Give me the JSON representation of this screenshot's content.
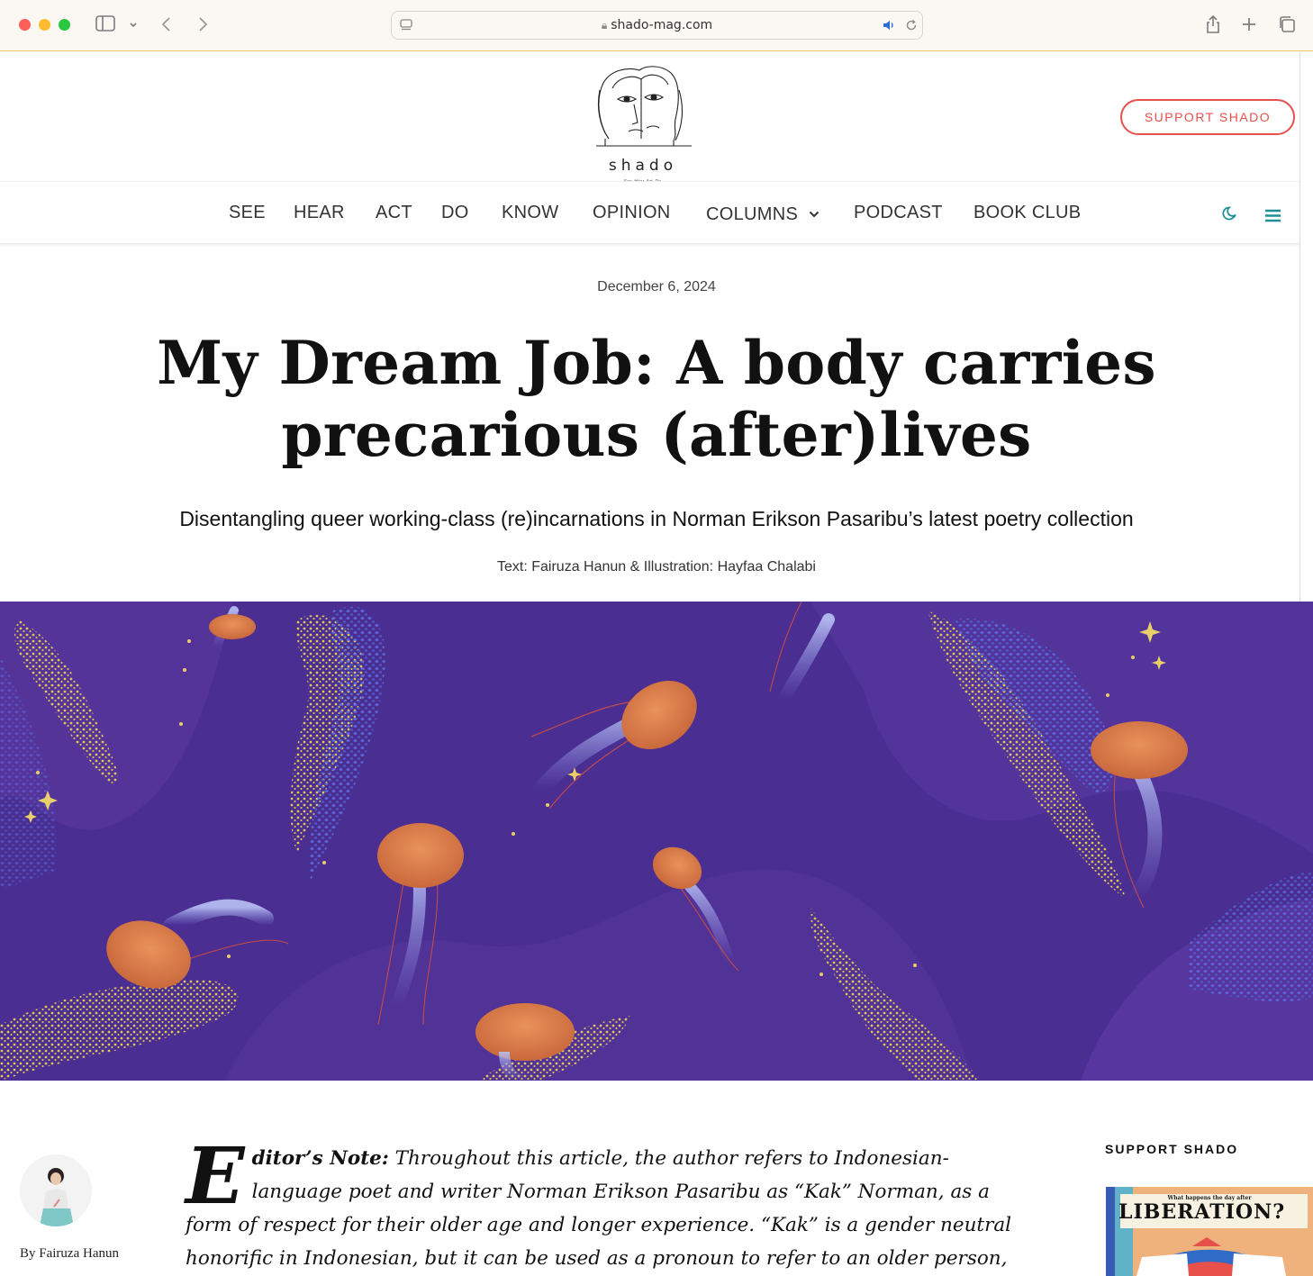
{
  "browser": {
    "url": "shado-mag.com"
  },
  "site": {
    "logo_text": "shado",
    "tagline": "See. Hear. Act. Do.",
    "support_button": "SUPPORT SHADO"
  },
  "nav": {
    "items": [
      "SEE",
      "HEAR",
      "ACT",
      "DO",
      "KNOW",
      "OPINION",
      "COLUMNS",
      "PODCAST",
      "BOOK CLUB"
    ]
  },
  "article": {
    "date": "December 6, 2024",
    "title_line1": "My Dream Job: A body carries",
    "title_line2": "precarious (after)lives",
    "subtitle": "Disentangling queer working-class (re)incarnations in Norman Erikson Pasaribu’s latest poetry collection",
    "credits": "Text: Fairuza Hanun & Illustration: Hayfaa Chalabi",
    "byline": "By Fairuza Hanun",
    "dropcap": "E",
    "note_label": "ditor’s Note:",
    "note_text": " Throughout this article, the author refers to Indonesian-language poet and writer Norman Erikson Pasaribu as “Kak” Norman, as a form of respect for their older age and longer experience. “Kak” is a gender neutral honorific in Indonesian, but it can be used as a pronoun to refer to an older person, because referring"
  },
  "sidebar": {
    "heading": "SUPPORT SHADO",
    "ad_small": "What happens the day after",
    "ad_big": "LIBERATION?"
  },
  "colors": {
    "accent_red": "#e8504c",
    "accent_teal": "#1e8f95",
    "hero_bg": "#4a2e92"
  }
}
